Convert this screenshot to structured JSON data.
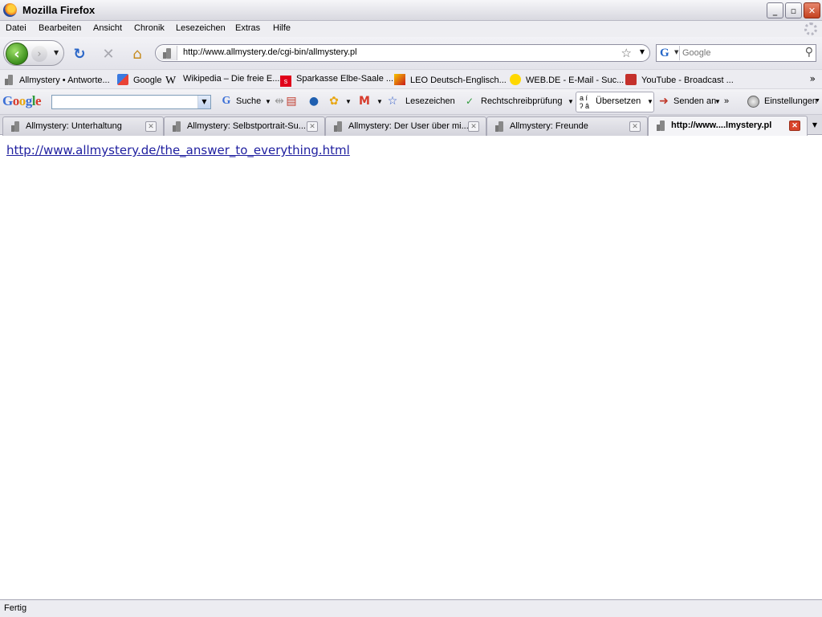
{
  "window": {
    "title": "Mozilla Firefox",
    "min_label": "_",
    "max_label": "▫",
    "close_label": "✕"
  },
  "menu": [
    "Datei",
    "Bearbeiten",
    "Ansicht",
    "Chronik",
    "Lesezeichen",
    "Extras",
    "Hilfe"
  ],
  "nav": {
    "url": "http://www.allmystery.de/cgi-bin/allmystery.pl",
    "search_placeholder": "Google",
    "search_engine": "G"
  },
  "bookmarks": [
    "Allmystery • Antworte...",
    "Google",
    "Wikipedia – Die freie E...",
    "Sparkasse Elbe-Saale ...",
    "LEO Deutsch-Englisch...",
    "WEB.DE - E-Mail - Suc...",
    "YouTube - Broadcast ..."
  ],
  "bookmarks_more": "»",
  "google_toolbar": {
    "logo": "Google",
    "search_label": "Suche",
    "bookmarks_label": "Lesezeichen",
    "spellcheck_label": "Rechtschreibprüfung",
    "translate_label": "Übersetzen",
    "send_label": "Senden an",
    "more": "»",
    "settings_label": "Einstellungen"
  },
  "tabs": [
    {
      "label": "Allmystery: Unterhaltung",
      "active": false
    },
    {
      "label": "Allmystery: Selbstportrait-Su...",
      "active": false
    },
    {
      "label": "Allmystery: Der User über mi...",
      "active": false
    },
    {
      "label": "Allmystery: Freunde",
      "active": false
    },
    {
      "label": "http://www....lmystery.pl",
      "active": true
    }
  ],
  "content": {
    "link": "http://www.allmystery.de/the_answer_to_everything.html"
  },
  "status": "Fertig",
  "colors": {
    "link": "#2020a0",
    "back_button": "#3c8f1c",
    "close_button": "#c4411f"
  }
}
